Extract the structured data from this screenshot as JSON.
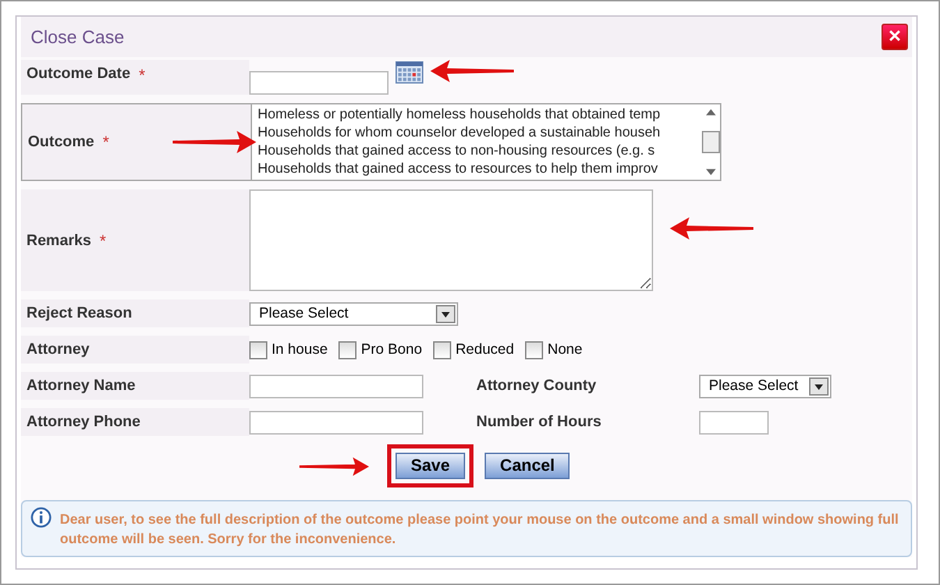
{
  "window": {
    "title": "Close Case",
    "close_label": "✕"
  },
  "required_mark": "*",
  "fields": [
    {
      "kind": "date",
      "label": "Outcome Date",
      "required": true
    },
    {
      "kind": "listbox",
      "label": "Outcome",
      "required": true,
      "options": [
        "Homeless or potentially homeless households that obtained temp",
        "Households for whom counselor developed a sustainable househ",
        "Households that gained access to non-housing resources (e.g. s",
        "Households that gained access to resources to help them improv"
      ]
    },
    {
      "kind": "textarea",
      "label": "Remarks",
      "required": true
    },
    {
      "kind": "select",
      "label": "Reject Reason",
      "required": false,
      "value": "Please Select"
    },
    {
      "kind": "checkboxes",
      "label": "Attorney",
      "required": false,
      "options": [
        {
          "label": "In house",
          "checked": false
        },
        {
          "label": "Pro Bono",
          "checked": false
        },
        {
          "label": "Reduced",
          "checked": false
        },
        {
          "label": "None",
          "checked": false
        }
      ]
    },
    {
      "kind": "pair",
      "label": "Attorney Name",
      "required": false,
      "second": {
        "kind": "select",
        "label": "Attorney County",
        "value": "Please Select"
      }
    },
    {
      "kind": "pair",
      "label": "Attorney Phone",
      "required": false,
      "second": {
        "kind": "text",
        "label": "Number of Hours"
      }
    }
  ],
  "buttons": [
    {
      "label": "Save",
      "highlighted": true
    },
    {
      "label": "Cancel",
      "highlighted": false
    }
  ],
  "info": "Dear user, to see the full description of the outcome please point your mouse on the outcome and a small window showing full outcome will be seen. Sorry for the inconvenience."
}
